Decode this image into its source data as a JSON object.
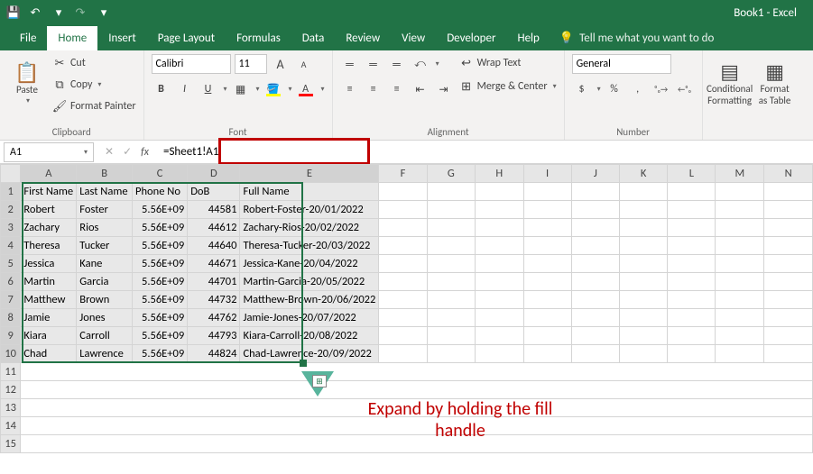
{
  "app": {
    "title": "Book1 - Excel"
  },
  "qat": {
    "save": "💾",
    "undo": "↶",
    "redo": "↷"
  },
  "tabs": {
    "items": [
      "File",
      "Home",
      "Insert",
      "Page Layout",
      "Formulas",
      "Data",
      "Review",
      "View",
      "Developer",
      "Help"
    ],
    "active": 1,
    "tell_me": "Tell me what you want to do"
  },
  "ribbon": {
    "clipboard": {
      "label": "Clipboard",
      "paste": "Paste",
      "cut": "Cut",
      "copy": "Copy",
      "format_painter": "Format Painter"
    },
    "font": {
      "label": "Font",
      "name": "Calibri",
      "size": "11",
      "increase": "A",
      "decrease": "A",
      "bold": "B",
      "italic": "I",
      "underline": "U"
    },
    "alignment": {
      "label": "Alignment",
      "wrap": "Wrap Text",
      "merge": "Merge & Center"
    },
    "number": {
      "label": "Number",
      "format": "General",
      "currency": "$",
      "percent": "%",
      "comma": ",",
      "inc_dec": ".0",
      "dec_dec": ".00"
    },
    "styles": {
      "conditional": "Conditional Formatting",
      "table": "Format as Table"
    }
  },
  "formula": {
    "cell_ref": "A1",
    "value": "=Sheet1!A1"
  },
  "columns": [
    "A",
    "B",
    "C",
    "D",
    "E",
    "F",
    "G",
    "H",
    "I",
    "J",
    "K",
    "L",
    "M",
    "N"
  ],
  "headers": [
    "First Name",
    "Last Name",
    "Phone No",
    "DoB",
    "Full Name"
  ],
  "rows": [
    {
      "a": "Robert",
      "b": "Foster",
      "c": "5.56E+09",
      "d": "44581",
      "e": "Robert-Foster-20/01/2022"
    },
    {
      "a": "Zachary",
      "b": "Rios",
      "c": "5.56E+09",
      "d": "44612",
      "e": "Zachary-Rios-20/02/2022"
    },
    {
      "a": "Theresa",
      "b": "Tucker",
      "c": "5.56E+09",
      "d": "44640",
      "e": "Theresa-Tucker-20/03/2022"
    },
    {
      "a": "Jessica",
      "b": "Kane",
      "c": "5.56E+09",
      "d": "44671",
      "e": "Jessica-Kane-20/04/2022"
    },
    {
      "a": "Martin",
      "b": "Garcia",
      "c": "5.56E+09",
      "d": "44701",
      "e": "Martin-Garcia-20/05/2022"
    },
    {
      "a": "Matthew",
      "b": "Brown",
      "c": "5.56E+09",
      "d": "44732",
      "e": "Matthew-Brown-20/06/2022"
    },
    {
      "a": "Jamie",
      "b": "Jones",
      "c": "5.56E+09",
      "d": "44762",
      "e": "Jamie-Jones-20/07/2022"
    },
    {
      "a": "Kiara",
      "b": "Carroll",
      "c": "5.56E+09",
      "d": "44793",
      "e": "Kiara-Carroll-20/08/2022"
    },
    {
      "a": "Chad",
      "b": "Lawrence",
      "c": "5.56E+09",
      "d": "44824",
      "e": "Chad-Lawrence-20/09/2022"
    }
  ],
  "annotation": "Expand by holding the fill handle"
}
